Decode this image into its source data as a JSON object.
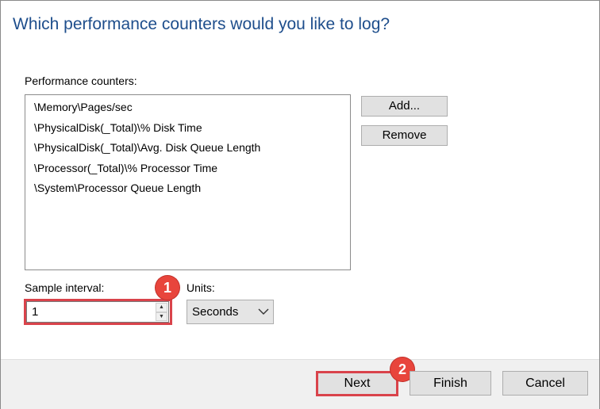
{
  "header": {
    "title": "Which performance counters would you like to log?"
  },
  "counters": {
    "label": "Performance counters:",
    "items": [
      "\\Memory\\Pages/sec",
      "\\PhysicalDisk(_Total)\\% Disk Time",
      "\\PhysicalDisk(_Total)\\Avg. Disk Queue Length",
      "\\Processor(_Total)\\% Processor Time",
      "\\System\\Processor Queue Length"
    ],
    "add_label": "Add...",
    "remove_label": "Remove"
  },
  "sample_interval": {
    "label": "Sample interval:",
    "value": "1"
  },
  "units": {
    "label": "Units:",
    "selected": "Seconds"
  },
  "footer": {
    "next_label": "Next",
    "finish_label": "Finish",
    "cancel_label": "Cancel"
  },
  "annotations": {
    "badge1": "1",
    "badge2": "2",
    "color": "#e8453c"
  }
}
